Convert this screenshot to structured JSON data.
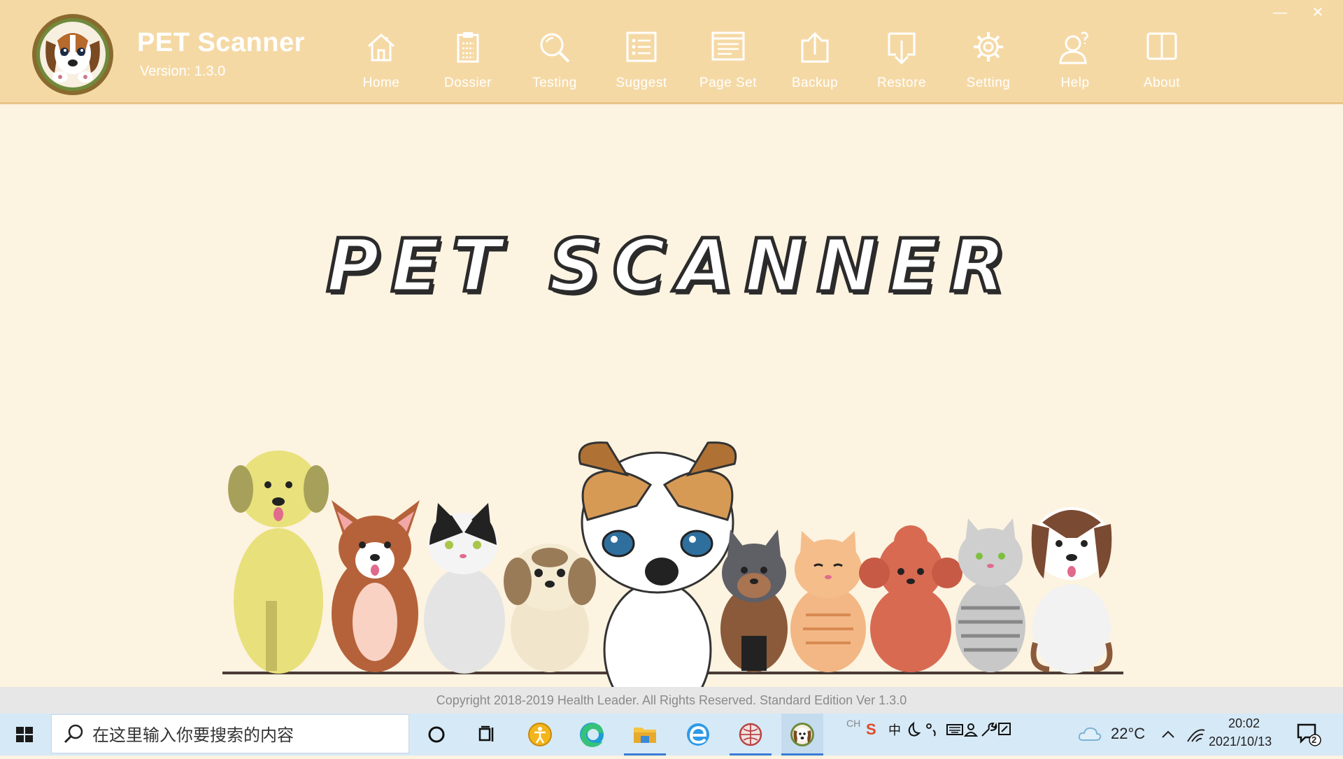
{
  "app": {
    "name": "PET Scanner",
    "version": "Version: 1.3.0",
    "main_title": "PET SCANNER",
    "nav": [
      {
        "label": "Home",
        "icon": "home-icon"
      },
      {
        "label": "Dossier",
        "icon": "clipboard-icon"
      },
      {
        "label": "Testing",
        "icon": "magnifier-icon"
      },
      {
        "label": "Suggest",
        "icon": "list-icon"
      },
      {
        "label": "Page Set",
        "icon": "page-layout-icon"
      },
      {
        "label": "Backup",
        "icon": "upload-icon"
      },
      {
        "label": "Restore",
        "icon": "download-icon"
      },
      {
        "label": "Setting",
        "icon": "gear-icon"
      },
      {
        "label": "Help",
        "icon": "user-question-icon"
      },
      {
        "label": "About",
        "icon": "book-icon"
      }
    ],
    "window_controls": {
      "minimize": "—",
      "close": "✕"
    },
    "footer": "Copyright 2018-2019 Health Leader. All Rights Reserved.  Standard Edition Ver 1.3.0"
  },
  "taskbar": {
    "search_placeholder": "在这里输入你要搜索的内容",
    "ime": "CH",
    "ime_mode": "中",
    "weather": "22°C",
    "time": "20:02",
    "date": "2021/10/13",
    "notifications": "2"
  },
  "colors": {
    "header": "#f5d9a5",
    "background": "#fdf3e1",
    "taskbar": "#d6e9f7"
  }
}
